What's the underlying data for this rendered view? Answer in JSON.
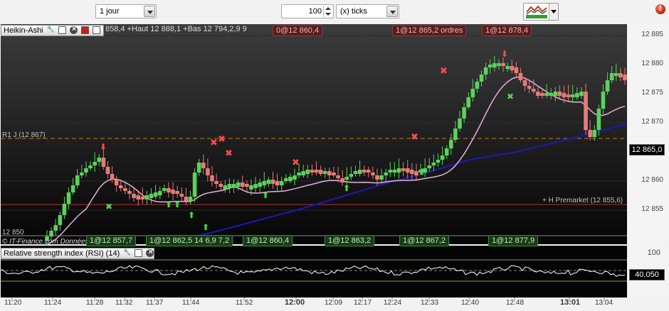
{
  "toolbar": {
    "period_value": "1 jour",
    "ticks_number": "100",
    "ticks_unit": "(x) ticks"
  },
  "main_panel": {
    "title": "Heikin-Ashi",
    "info_text": "858,4 +Haut 12 888,1 +Bas 12 794,2,9  9",
    "r1_label": "R1 J (12 867)",
    "premarket_label": "+ H Premarket (12 855,6)",
    "low_label": "12 850",
    "copyright": "© IT-Finance.com Données indicatives",
    "current_price": "12 865,0",
    "y_ticks": [
      "12 885",
      "12 880",
      "12 875",
      "12 870",
      "12 860",
      "12 855"
    ],
    "top_tags": [
      "0@12 860,4",
      "1@12 865,2 ordres",
      "1@12 878,4"
    ],
    "bottom_tags": [
      "1@12 857,7",
      "1@12 862,5 14 6,9 7,2",
      "1@12 860,4",
      "1@12 863,2",
      "1@12 867,2",
      "1@12 877,9"
    ]
  },
  "rsi_panel": {
    "title": "Relative strength index (RSI) (14)",
    "top_level": "100",
    "current_value": "40,050"
  },
  "x_axis": {
    "labels": [
      "11:20",
      "11:24",
      "11:28",
      "11:32",
      "11:37",
      "11:44",
      "11:52",
      "12:00",
      "12:09",
      "12:17",
      "12:24",
      "12:33",
      "12:40",
      "12:48",
      "13:01",
      "13:04"
    ],
    "bold_labels": [
      "12:00",
      "13:01"
    ]
  },
  "colors": {
    "bull": "#5ad35a",
    "bear": "#e87a7a",
    "ma_fast": "#e8b0e0",
    "ma_slow": "#1a1ab4",
    "r1_line": "#c8781e",
    "premarket_line": "#b43030"
  }
}
